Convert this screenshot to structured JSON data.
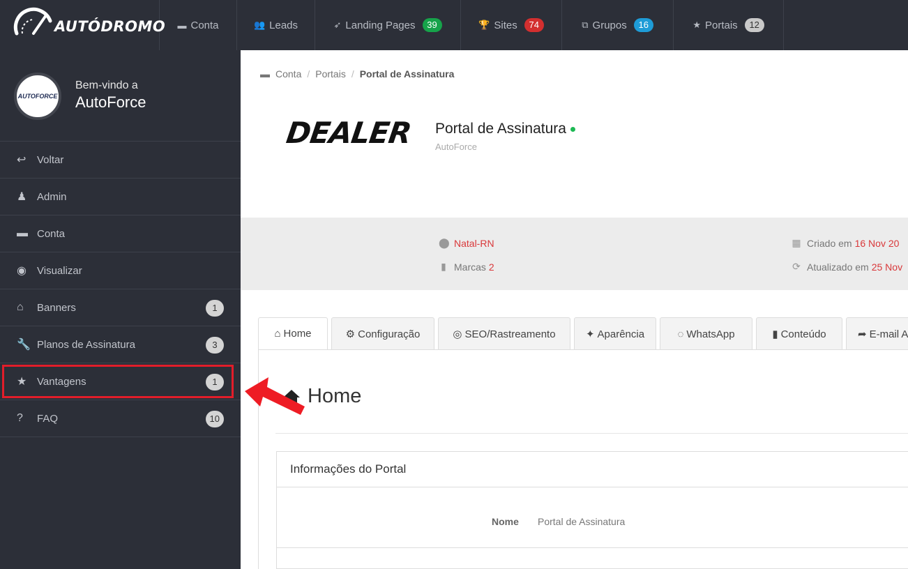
{
  "brand": {
    "logo_text": "AUTÓDROMO"
  },
  "topnav": [
    {
      "id": "conta",
      "icon": "archive-icon",
      "label": "Conta",
      "badge": null
    },
    {
      "id": "leads",
      "icon": "users-icon",
      "label": "Leads",
      "badge": null
    },
    {
      "id": "landing",
      "icon": "rocket-icon",
      "label": "Landing Pages",
      "badge": "39",
      "badge_color": "#16a34a"
    },
    {
      "id": "sites",
      "icon": "trophy-icon",
      "label": "Sites",
      "badge": "74",
      "badge_color": "#d32f2f"
    },
    {
      "id": "grupos",
      "icon": "cubes-icon",
      "label": "Grupos",
      "badge": "16",
      "badge_color": "#1e9cd7"
    },
    {
      "id": "portais",
      "icon": "star-icon",
      "label": "Portais",
      "badge": "12",
      "badge_color": "#c9c9c9"
    }
  ],
  "sidebar": {
    "welcome": "Bem-vindo a",
    "name": "AutoForce",
    "avatar_text": "AUTOFORCE",
    "items": [
      {
        "icon": "reply-icon",
        "label": "Voltar",
        "badge": null
      },
      {
        "icon": "user-admin-icon",
        "label": "Admin",
        "badge": null
      },
      {
        "icon": "archive-icon",
        "label": "Conta",
        "badge": null
      },
      {
        "icon": "eye-icon",
        "label": "Visualizar",
        "badge": null
      },
      {
        "icon": "store-icon",
        "label": "Banners",
        "badge": "1"
      },
      {
        "icon": "wrench-icon",
        "label": "Planos de Assinatura",
        "badge": "3"
      },
      {
        "icon": "star-icon",
        "label": "Vantagens",
        "badge": "1"
      },
      {
        "icon": "question-icon",
        "label": "FAQ",
        "badge": "10"
      }
    ]
  },
  "breadcrumb": {
    "items": [
      "Conta",
      "Portais"
    ],
    "active": "Portal de Assinatura"
  },
  "portal": {
    "logo_text": "DEALER",
    "title": "Portal de Assinatura",
    "status_color": "#1db954",
    "subtitle": "AutoForce"
  },
  "info": {
    "location": "Natal-RN",
    "brands_label": "Marcas",
    "brands_count": "2",
    "created_label": "Criado em",
    "created_value": "16 Nov 20",
    "updated_label": "Atualizado em",
    "updated_value": "25 Nov"
  },
  "tabs": [
    {
      "icon": "home-icon",
      "label": "Home",
      "active": true
    },
    {
      "icon": "cog-icon",
      "label": "Configuração"
    },
    {
      "icon": "globe-icon",
      "label": "SEO/Rastreamento"
    },
    {
      "icon": "magic-icon",
      "label": "Aparência"
    },
    {
      "icon": "whatsapp-icon",
      "label": "WhatsApp"
    },
    {
      "icon": "book-icon",
      "label": "Conteúdo"
    },
    {
      "icon": "share-icon",
      "label": "E-mail A"
    }
  ],
  "home": {
    "heading": "Home",
    "panel_title": "Informações do Portal",
    "field_label": "Nome",
    "field_value": "Portal de Assinatura"
  }
}
